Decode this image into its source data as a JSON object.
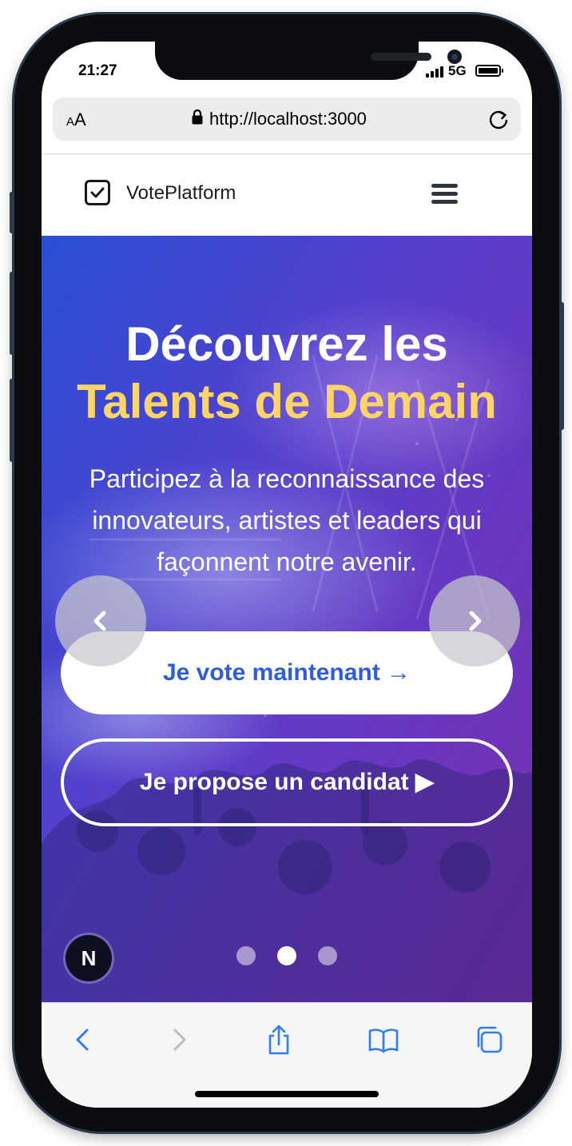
{
  "status": {
    "time": "21:27",
    "network": "5G"
  },
  "browser": {
    "text_size_small": "A",
    "text_size_large": "A",
    "url": "http://localhost:3000"
  },
  "navbar": {
    "brand": "VotePlatform"
  },
  "hero": {
    "title_line1": "Découvrez les",
    "title_line2": "Talents de Demain",
    "subtitle": "Participez à la reconnaissance des innovateurs, artistes et leaders qui façonnent notre avenir.",
    "primary_button": "Je vote maintenant →",
    "secondary_button": "Je propose un candidat ▶",
    "carousel": {
      "slides": 3,
      "active_index": 1
    },
    "badge_letter": "N"
  },
  "colors": {
    "accent_blue": "#2f5be0",
    "highlight_yellow": "#fcd468",
    "ios_blue": "#2f7cf6"
  },
  "icons": [
    "check-square-icon",
    "hamburger-menu-icon",
    "lock-icon",
    "reload-icon",
    "chevron-left-icon",
    "chevron-right-icon",
    "share-icon",
    "bookmarks-icon",
    "tabs-icon"
  ]
}
